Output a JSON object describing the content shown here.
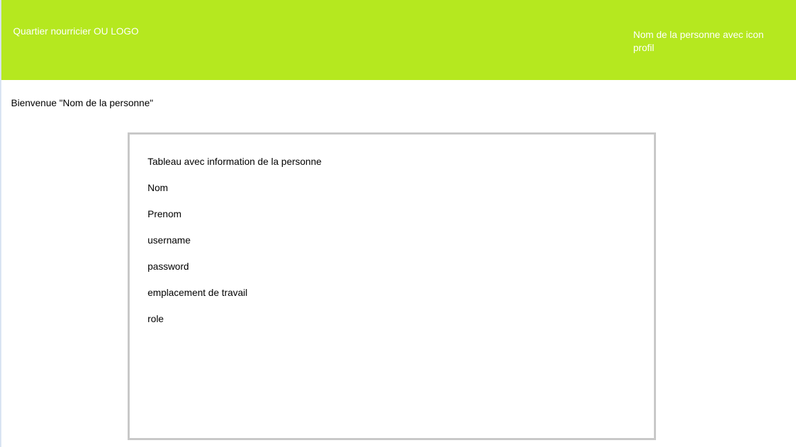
{
  "header": {
    "logo_text": "Quartier nourricier OU LOGO",
    "profile_text": "Nom de la personne avec icon profil"
  },
  "welcome": {
    "text": "Bienvenue \"Nom de la personne\""
  },
  "info_panel": {
    "title": "Tableau avec information de la personne",
    "fields": [
      {
        "label": "Nom"
      },
      {
        "label": "Prenom"
      },
      {
        "label": "username"
      },
      {
        "label": "password"
      },
      {
        "label": "emplacement de travail"
      },
      {
        "label": "role"
      }
    ]
  },
  "colors": {
    "header_bg": "#b5e81f",
    "header_text": "#ffffff",
    "panel_border": "#c8c8c8"
  }
}
